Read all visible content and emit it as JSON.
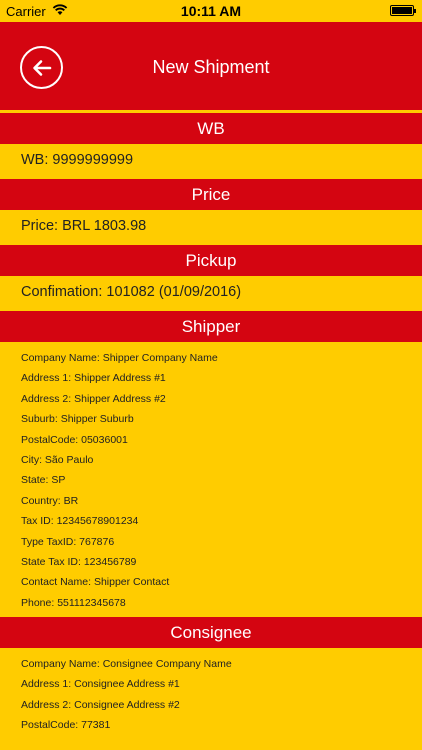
{
  "status": {
    "carrier": "Carrier",
    "time": "10:11 AM",
    "battery_level": 1.0
  },
  "nav": {
    "title": "New Shipment",
    "back_icon": "arrow-left-circle-icon"
  },
  "colors": {
    "brand_red": "#d40511",
    "brand_yellow": "#ffcc00"
  },
  "wb": {
    "header": "WB",
    "value": "WB: 9999999999"
  },
  "price": {
    "header": "Price",
    "value": "Price: BRL 1803.98"
  },
  "pickup": {
    "header": "Pickup",
    "value": "Confimation: 101082 (01/09/2016)"
  },
  "shipper": {
    "header": "Shipper",
    "rows": [
      "Company Name: Shipper Company Name",
      "Address 1: Shipper Address #1",
      "Address 2: Shipper Address #2",
      "Suburb: Shipper Suburb",
      "PostalCode: 05036001",
      "City: São Paulo",
      "State: SP",
      "Country: BR",
      "Tax ID: 12345678901234",
      "Type TaxID: 767876",
      "State Tax ID: 123456789",
      "Contact Name: Shipper Contact",
      "Phone: 551112345678"
    ]
  },
  "consignee": {
    "header": "Consignee",
    "rows": [
      "Company Name: Consignee Company Name",
      "Address 1: Consignee Address #1",
      "Address 2: Consignee Address #2",
      "PostalCode: 77381"
    ]
  }
}
